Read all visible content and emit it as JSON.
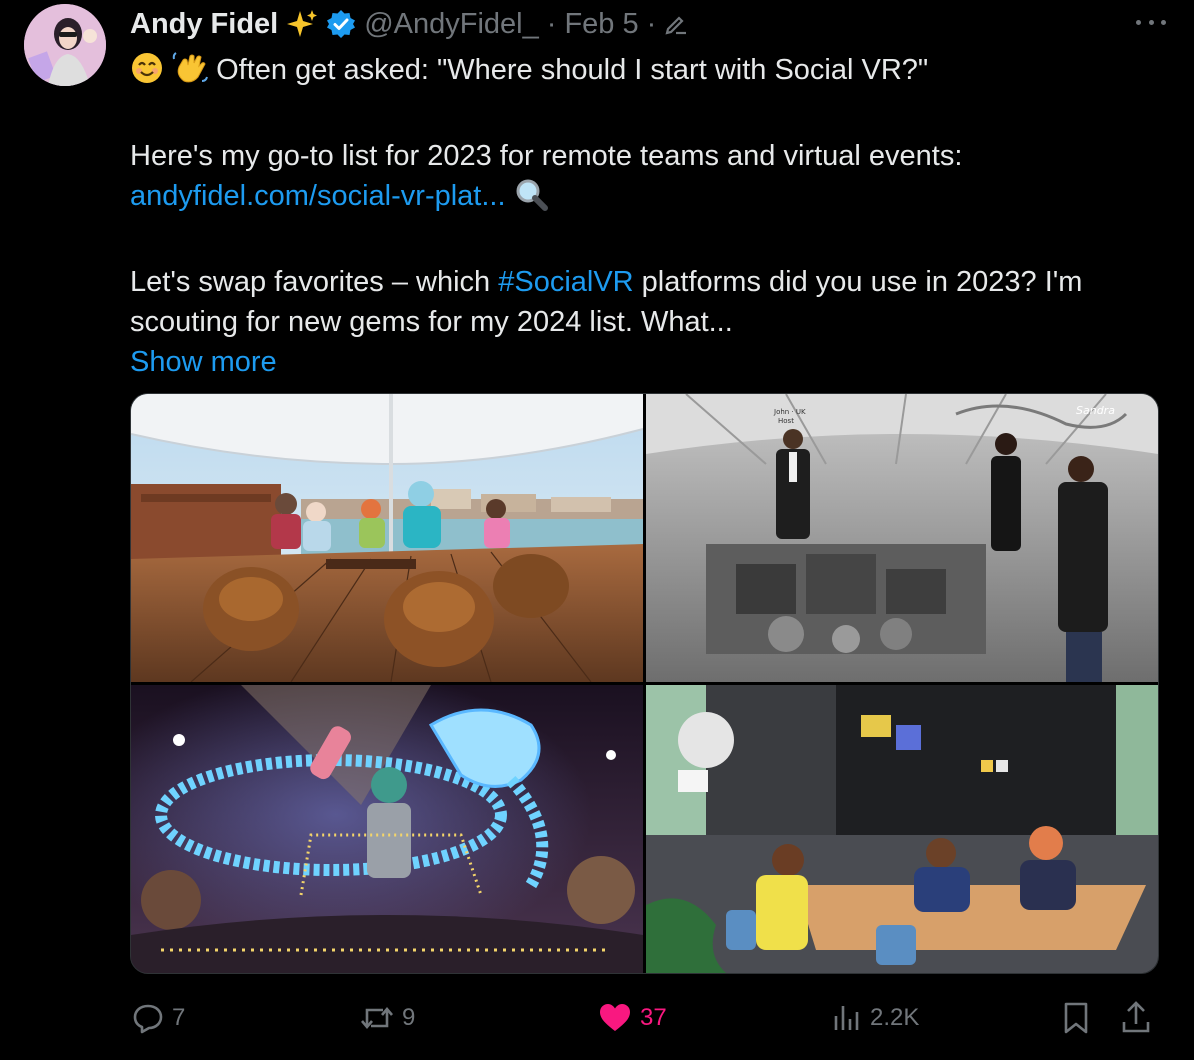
{
  "tweet": {
    "author_name": "Andy Fidel",
    "handle": "@AndyFidel_",
    "separator": "·",
    "date": "Feb 5",
    "line1": "Often get asked: \"Where should I start with Social VR?\"",
    "line2": "Here's my go-to list for 2023 for remote teams and virtual events:",
    "link_text": "andyfidel.com/social-vr-plat...",
    "line3_pre": "Let's swap favorites – which ",
    "hashtag": "#SocialVR",
    "line3_post": " platforms did you use in 2023? I'm scouting for new gems for my 2024 list. What...",
    "show_more": "Show more"
  },
  "media": {
    "tile2_labels": {
      "host": "John · UK",
      "host_role": "Host",
      "guest": "Sandra"
    }
  },
  "actions": {
    "replies": "7",
    "reposts": "9",
    "likes": "37",
    "views": "2.2K"
  },
  "colors": {
    "background": "#000000",
    "text": "#e7e9ea",
    "muted": "#71767b",
    "link": "#1d9bf0",
    "like": "#f91880",
    "verified": "#1d9bf0"
  },
  "icons": [
    "sparkles-icon",
    "verified-badge-icon",
    "edit-icon",
    "more-icon",
    "smile-emoji-icon",
    "wave-emoji-icon",
    "magnifier-emoji-icon",
    "reply-icon",
    "repost-icon",
    "like-icon",
    "views-icon",
    "bookmark-icon",
    "share-icon"
  ]
}
